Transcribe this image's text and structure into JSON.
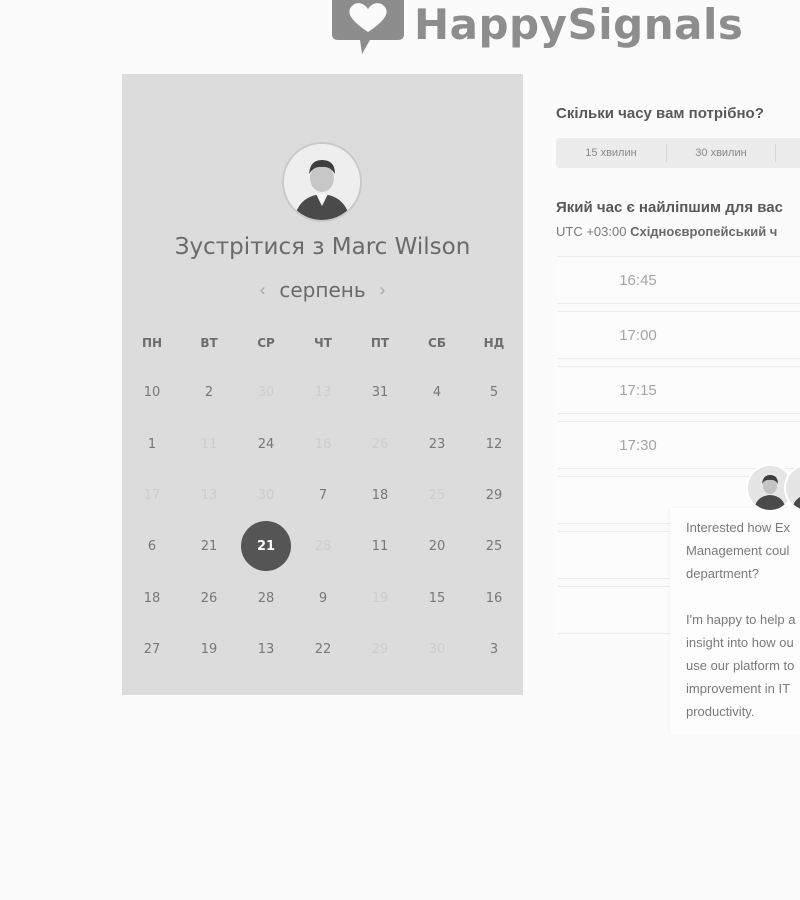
{
  "brand": {
    "name": "HappySignals"
  },
  "host": {
    "meet_title": "Зустрітися з Marc Wilson",
    "month": "серпень",
    "prev_arrow": "‹",
    "next_arrow": "›"
  },
  "weekdays": [
    "ПН",
    "ВТ",
    "СР",
    "ЧТ",
    "ПТ",
    "СБ",
    "НД"
  ],
  "weeks": [
    [
      {
        "d": "10"
      },
      {
        "d": "2"
      },
      {
        "d": "30",
        "muted": true
      },
      {
        "d": "13",
        "muted": true
      },
      {
        "d": "31"
      },
      {
        "d": "4"
      },
      {
        "d": "5"
      }
    ],
    [
      {
        "d": "1"
      },
      {
        "d": "11",
        "muted": true
      },
      {
        "d": "24"
      },
      {
        "d": "16",
        "muted": true
      },
      {
        "d": "26",
        "muted": true
      },
      {
        "d": "23"
      },
      {
        "d": "12"
      }
    ],
    [
      {
        "d": "17",
        "muted": true
      },
      {
        "d": "13",
        "muted": true
      },
      {
        "d": "30",
        "muted": true
      },
      {
        "d": "7"
      },
      {
        "d": "18"
      },
      {
        "d": "25",
        "muted": true
      },
      {
        "d": "29"
      }
    ],
    [
      {
        "d": "6"
      },
      {
        "d": "21"
      },
      {
        "d": "21",
        "selected": true
      },
      {
        "d": "28",
        "muted": true
      },
      {
        "d": "11"
      },
      {
        "d": "20"
      },
      {
        "d": "25"
      }
    ],
    [
      {
        "d": "18"
      },
      {
        "d": "26"
      },
      {
        "d": "28"
      },
      {
        "d": "9"
      },
      {
        "d": "19",
        "muted": true
      },
      {
        "d": "15"
      },
      {
        "d": "16"
      }
    ],
    [
      {
        "d": "27"
      },
      {
        "d": "19"
      },
      {
        "d": "13"
      },
      {
        "d": "22"
      },
      {
        "d": "29",
        "muted": true
      },
      {
        "d": "30",
        "muted": true
      },
      {
        "d": "3"
      }
    ]
  ],
  "booking": {
    "duration_question": "Скільки часу вам потрібно?",
    "durations": [
      "15 хвилин",
      "30 хвилин"
    ],
    "time_question": "Який час є найліпшим для вас",
    "timezone_prefix": "UTC +03:00",
    "timezone_name": "Східноєвропейський ч",
    "slots": [
      "16:45",
      "17:00",
      "17:15",
      "17:30"
    ]
  },
  "chat": {
    "message": "Interested how Ex\nManagement coul\ndepartment?\n\nI'm happy to help a\ninsight into how ou\nuse our platform to\nimprovement in IT\nproductivity."
  },
  "colors": {
    "logo": "#8d8d8d",
    "panel": "#dcdcdc",
    "selected_day": "#555555"
  }
}
